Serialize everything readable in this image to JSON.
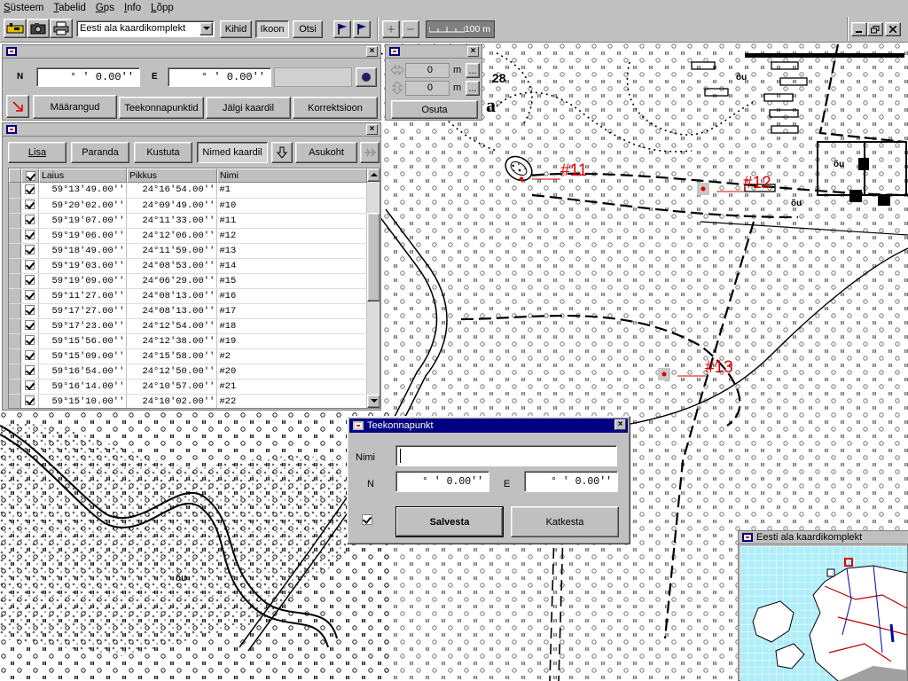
{
  "menu": [
    "Süsteem",
    "Tabelid",
    "Gps",
    "Info",
    "Lõpp"
  ],
  "toolbar": {
    "map_select": "Eesti ala kaardikomplekt",
    "layers_label": "Kihid",
    "icons_label": "Ikoon",
    "search_label": "Otsi",
    "zoom_in": "+",
    "zoom_out": "−",
    "scale_label": "100 m"
  },
  "coords_panel": {
    "n_label": "N",
    "e_label": "E",
    "n_value": "°  '  0.00''",
    "e_value": "°  '  0.00''",
    "tabs": [
      "Määrangud",
      "Teekonnapunktid",
      "Jälgi kaardil",
      "Korrektsioon"
    ]
  },
  "offset_panel": {
    "dx": "0",
    "dy": "0",
    "unit": "m",
    "more": "...",
    "apply_label": "Osuta"
  },
  "waypoints_panel": {
    "buttons": [
      "Lisa",
      "Paranda",
      "Kustuta",
      "Nimed kaardil",
      "Asukoht"
    ],
    "columns": [
      "Laius",
      "Pikkus",
      "Nimi"
    ],
    "rows": [
      {
        "lat": "59°13'49.00''",
        "lon": "24°16'54.00''",
        "name": "#1"
      },
      {
        "lat": "59°20'02.00''",
        "lon": "24°09'49.00''",
        "name": "#10"
      },
      {
        "lat": "59°19'07.00''",
        "lon": "24°11'33.00''",
        "name": "#11"
      },
      {
        "lat": "59°19'06.00''",
        "lon": "24°12'06.00''",
        "name": "#12"
      },
      {
        "lat": "59°18'49.00''",
        "lon": "24°11'59.00''",
        "name": "#13"
      },
      {
        "lat": "59°19'03.00''",
        "lon": "24°08'53.00''",
        "name": "#14"
      },
      {
        "lat": "59°19'09.00''",
        "lon": "24°06'29.00''",
        "name": "#15"
      },
      {
        "lat": "59°11'27.00''",
        "lon": "24°08'13.00''",
        "name": "#16"
      },
      {
        "lat": "59°17'27.00''",
        "lon": "24°08'13.00''",
        "name": "#17"
      },
      {
        "lat": "59°17'23.00''",
        "lon": "24°12'54.00''",
        "name": "#18"
      },
      {
        "lat": "59°15'56.00''",
        "lon": "24°12'38.00''",
        "name": "#19"
      },
      {
        "lat": "59°15'09.00''",
        "lon": "24°15'58.00''",
        "name": "#2"
      },
      {
        "lat": "59°16'54.00''",
        "lon": "24°12'50.00''",
        "name": "#20"
      },
      {
        "lat": "59°16'14.00''",
        "lon": "24°10'57.00''",
        "name": "#21"
      },
      {
        "lat": "59°15'10.00''",
        "lon": "24°10'02.00''",
        "name": "#22"
      }
    ]
  },
  "map": {
    "number_28": "28",
    "letter_a": "a",
    "labels_ou": "õu",
    "markers": [
      "#11",
      "#12",
      "#13"
    ],
    "marker_color": "#e00000"
  },
  "dialog": {
    "title": "Teekonnapunkt",
    "name_label": "Nimi",
    "name_value": "",
    "n_label": "N",
    "e_label": "E",
    "n_value": "°  '  0.00''",
    "e_value": "°  '  0.00''",
    "save_label": "Salvesta",
    "cancel_label": "Katkesta"
  },
  "minimap": {
    "title": "Eesti ala kaardikomplekt"
  },
  "colors": {
    "title_blue": "#000080",
    "minimap_sea": "#aeeefa"
  }
}
